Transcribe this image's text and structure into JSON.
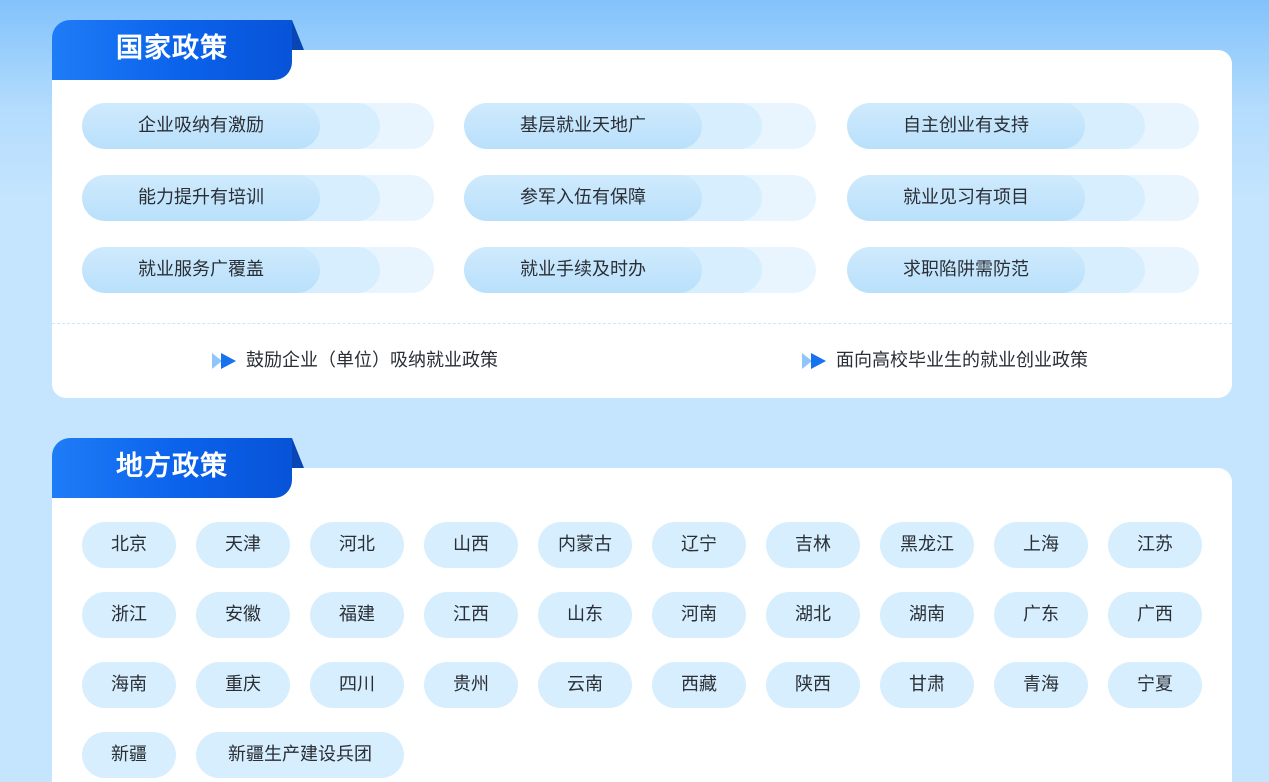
{
  "national": {
    "title": "国家政策",
    "items": [
      "企业吸纳有激励",
      "基层就业天地广",
      "自主创业有支持",
      "能力提升有培训",
      "参军入伍有保障",
      "就业见习有项目",
      "就业服务广覆盖",
      "就业手续及时办",
      "求职陷阱需防范"
    ],
    "links": [
      "鼓励企业（单位）吸纳就业政策",
      "面向高校毕业生的就业创业政策"
    ]
  },
  "local": {
    "title": "地方政策",
    "regions": [
      "北京",
      "天津",
      "河北",
      "山西",
      "内蒙古",
      "辽宁",
      "吉林",
      "黑龙江",
      "上海",
      "江苏",
      "浙江",
      "安徽",
      "福建",
      "江西",
      "山东",
      "河南",
      "湖北",
      "湖南",
      "广东",
      "广西",
      "海南",
      "重庆",
      "四川",
      "贵州",
      "云南",
      "西藏",
      "陕西",
      "甘肃",
      "青海",
      "宁夏",
      "新疆",
      "新疆生产建设兵团"
    ]
  },
  "icons": {
    "link_arrow": "double-play-arrow-icon"
  },
  "colors": {
    "accent": "#0a62ea",
    "chip": "#d6eefd",
    "card": "#ffffff"
  }
}
